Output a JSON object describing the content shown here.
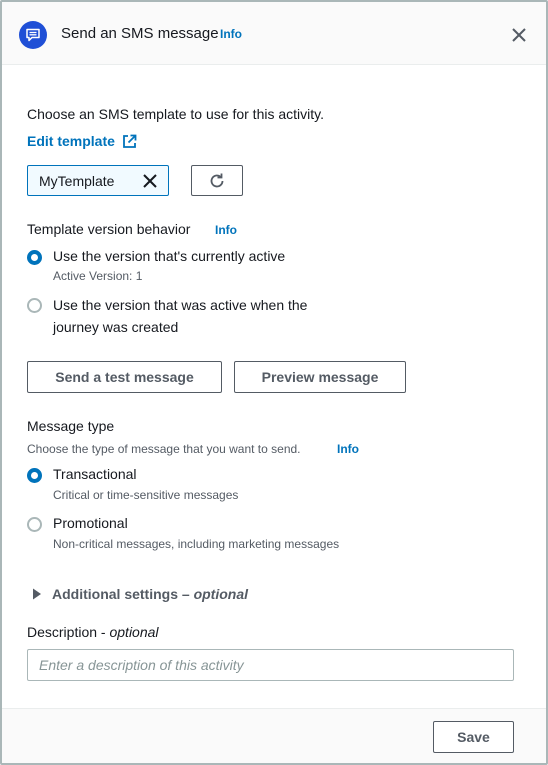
{
  "header": {
    "title": "Send an SMS message",
    "info": "Info",
    "icon": "sms-icon",
    "close_icon": "close-icon"
  },
  "template": {
    "intro": "Choose an SMS template to use for this activity.",
    "edit_link": "Edit template",
    "selected": "MyTemplate"
  },
  "version": {
    "label": "Template version behavior",
    "info": "Info",
    "options": [
      {
        "label": "Use the version that's currently active",
        "desc": "Active Version: 1",
        "checked": true
      },
      {
        "label_line1": "Use the version that was active when the",
        "label_line2": "journey was created",
        "checked": false
      }
    ]
  },
  "actions": {
    "test": "Send a test message",
    "preview": "Preview message"
  },
  "message_type": {
    "label": "Message type",
    "hint": "Choose the type of message that you want to send.",
    "info": "Info",
    "options": [
      {
        "label": "Transactional",
        "desc": "Critical or time-sensitive messages",
        "checked": true
      },
      {
        "label": "Promotional",
        "desc": "Non-critical messages, including marketing messages",
        "checked": false
      }
    ]
  },
  "additional": {
    "label": "Additional settings –",
    "optional": "optional"
  },
  "description": {
    "label": "Description -",
    "optional": "optional",
    "placeholder": "Enter a description of this activity",
    "value": ""
  },
  "footer": {
    "save": "Save"
  },
  "colors": {
    "accent": "#0073bb",
    "icon_bg": "#1f4fd6",
    "border": "#aab7b8",
    "muted_text": "#545b64"
  }
}
